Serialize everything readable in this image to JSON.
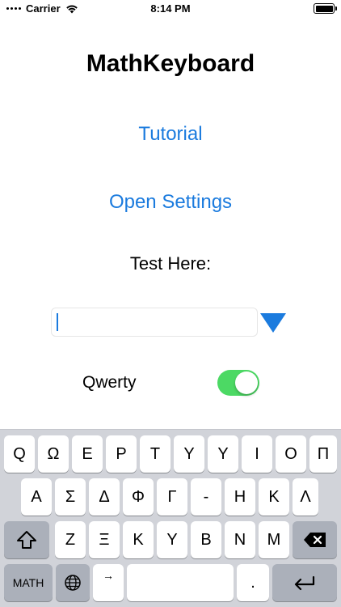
{
  "status_bar": {
    "carrier": "Carrier",
    "time": "8:14 PM"
  },
  "title": "MathKeyboard",
  "links": {
    "tutorial": "Tutorial",
    "open_settings": "Open Settings"
  },
  "test_label": "Test Here:",
  "test_field": {
    "value": "",
    "placeholder": ""
  },
  "qwerty": {
    "label": "Qwerty",
    "enabled": true
  },
  "colors": {
    "link": "#1b7bde",
    "toggle_on": "#4cd964",
    "keyboard_bg": "#d1d3d9"
  },
  "keyboard": {
    "row1": [
      "Q",
      "Ω",
      "E",
      "Ρ",
      "Τ",
      "Υ",
      "Υ",
      "Ι",
      "Ο",
      "Π"
    ],
    "row2": [
      "Α",
      "Σ",
      "Δ",
      "Φ",
      "Γ",
      "-",
      "Η",
      "Κ",
      "Λ"
    ],
    "row3": [
      "Ζ",
      "Ξ",
      "Κ",
      "Υ",
      "Β",
      "Ν",
      "Μ"
    ],
    "math_key": "MATH",
    "arrow_key": "→",
    "period_key": ".",
    "icons": {
      "shift": "shift-icon",
      "delete": "delete-icon",
      "globe": "globe-icon",
      "return": "return-icon"
    }
  }
}
